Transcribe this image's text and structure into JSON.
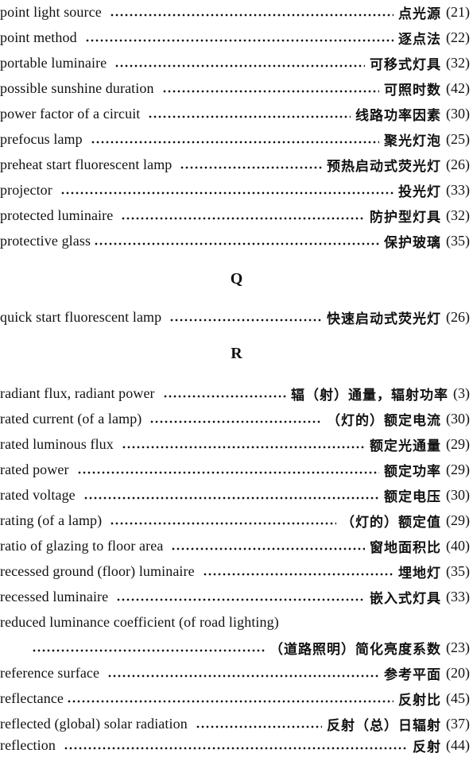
{
  "sections": {
    "p_entries": [
      {
        "en": "point light source",
        "cn": "点光源",
        "page": "(21)"
      },
      {
        "en": "point method",
        "cn": "逐点法",
        "page": "(22)"
      },
      {
        "en": "portable luminaire",
        "cn": "可移式灯具",
        "page": "(32)"
      },
      {
        "en": "possible sunshine duration",
        "cn": "可照时数",
        "page": "(42)"
      },
      {
        "en": "power factor of a circuit",
        "cn": "线路功率因素",
        "page": "(30)"
      },
      {
        "en": "prefocus lamp",
        "cn": "聚光灯泡",
        "page": "(25)"
      },
      {
        "en": "preheat start fluorescent lamp",
        "cn": "预热启动式荧光灯",
        "page": "(26)"
      },
      {
        "en": "projector",
        "cn": "投光灯",
        "page": "(33)"
      },
      {
        "en": "protected luminaire",
        "cn": "防护型灯具",
        "page": "(32)"
      },
      {
        "en": "protective glass",
        "cn": "保护玻璃",
        "page": "(35)"
      }
    ],
    "q_heading": "Q",
    "q_entries": [
      {
        "en": "quick start fluorescent lamp",
        "cn": "快速启动式荧光灯",
        "page": "(26)"
      }
    ],
    "r_heading": "R",
    "r_entries": [
      {
        "en": "radiant flux, radiant power",
        "cn": "辐（射）通量，辐射功率",
        "page": "(3)"
      },
      {
        "en": "rated current (of a lamp)",
        "cn": "（灯的）额定电流",
        "page": "(30)"
      },
      {
        "en": "rated luminous flux",
        "cn": "额定光通量",
        "page": "(29)"
      },
      {
        "en": "rated power",
        "cn": "额定功率",
        "page": "(29)"
      },
      {
        "en": "rated voltage",
        "cn": "额定电压",
        "page": "(30)"
      },
      {
        "en": "rating (of a lamp)",
        "cn": "（灯的）额定值",
        "page": "(29)"
      },
      {
        "en": "ratio of glazing to floor area",
        "cn": "窗地面积比",
        "page": "(40)"
      },
      {
        "en": "recessed ground (floor) luminaire",
        "cn": "埋地灯",
        "page": "(35)"
      },
      {
        "en": "recessed luminaire",
        "cn": "嵌入式灯具",
        "page": "(33)"
      },
      {
        "en": "reduced luminance coefficient (of road lighting)",
        "cn": "（道路照明）简化亮度系数",
        "page": "(23)"
      },
      {
        "en": "reference surface",
        "cn": "参考平面",
        "page": "(20)"
      },
      {
        "en": "reflectance",
        "cn": "反射比",
        "page": "(45)"
      },
      {
        "en": "reflected (global) solar radiation",
        "cn": "反射（总）日辐射",
        "page": "(37)"
      },
      {
        "en": "reflection",
        "cn": "反射",
        "page": "(44)"
      }
    ]
  }
}
